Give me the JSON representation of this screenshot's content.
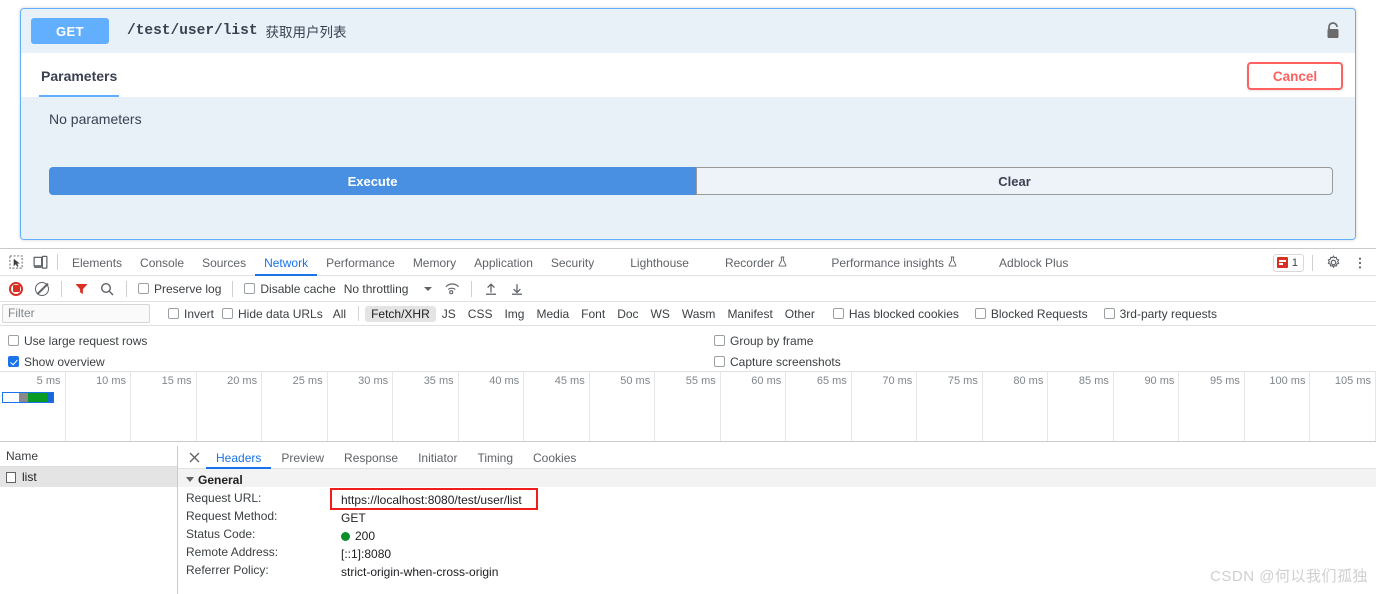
{
  "swagger": {
    "method": "GET",
    "path": "/test/user/list",
    "summary": "获取用户列表",
    "lock_icon": "unlocked-padlock-icon",
    "tab_parameters": "Parameters",
    "cancel_label": "Cancel",
    "no_parameters": "No parameters",
    "execute_label": "Execute",
    "clear_label": "Clear",
    "accent": "#61affe",
    "execute_color": "#4990e2",
    "cancel_color": "#ff6060"
  },
  "devtools": {
    "inspect_icon": "inspect-element-icon",
    "device_icon": "device-toolbar-icon",
    "tabs": [
      {
        "label": "Elements",
        "active": false,
        "experiment": false
      },
      {
        "label": "Console",
        "active": false,
        "experiment": false
      },
      {
        "label": "Sources",
        "active": false,
        "experiment": false
      },
      {
        "label": "Network",
        "active": true,
        "experiment": false
      },
      {
        "label": "Performance",
        "active": false,
        "experiment": false
      },
      {
        "label": "Memory",
        "active": false,
        "experiment": false
      },
      {
        "label": "Application",
        "active": false,
        "experiment": false
      },
      {
        "label": "Security",
        "active": false,
        "experiment": false
      },
      {
        "label": "Lighthouse",
        "active": false,
        "experiment": false
      },
      {
        "label": "Recorder",
        "active": false,
        "experiment": true
      },
      {
        "label": "Performance insights",
        "active": false,
        "experiment": true
      },
      {
        "label": "Adblock Plus",
        "active": false,
        "experiment": false
      }
    ],
    "error_count": "1",
    "settings_icon": "gear-icon",
    "more_icon": "kebab-menu-icon",
    "toolbar": {
      "record_icon": "record-stop-icon",
      "clear_icon": "clear-network-log-icon",
      "filter_icon": "filter-funnel-icon",
      "search_icon": "search-icon",
      "preserve_log": {
        "label": "Preserve log",
        "checked": false
      },
      "disable_cache": {
        "label": "Disable cache",
        "checked": false
      },
      "throttling": "No throttling",
      "wifi_icon": "network-conditions-icon",
      "import_icon": "import-har-icon",
      "export_icon": "export-har-icon"
    },
    "filterbar": {
      "filter_placeholder": "Filter",
      "filter_value": "",
      "invert": {
        "label": "Invert",
        "checked": false
      },
      "hide_data_urls": {
        "label": "Hide data URLs",
        "checked": false
      },
      "types": [
        {
          "label": "All",
          "selected": false
        },
        {
          "label": "Fetch/XHR",
          "selected": true
        },
        {
          "label": "JS",
          "selected": false
        },
        {
          "label": "CSS",
          "selected": false
        },
        {
          "label": "Img",
          "selected": false
        },
        {
          "label": "Media",
          "selected": false
        },
        {
          "label": "Font",
          "selected": false
        },
        {
          "label": "Doc",
          "selected": false
        },
        {
          "label": "WS",
          "selected": false
        },
        {
          "label": "Wasm",
          "selected": false
        },
        {
          "label": "Manifest",
          "selected": false
        },
        {
          "label": "Other",
          "selected": false
        }
      ],
      "has_blocked_cookies": {
        "label": "Has blocked cookies",
        "checked": false
      },
      "blocked_requests": {
        "label": "Blocked Requests",
        "checked": false
      },
      "third_party": {
        "label": "3rd-party requests",
        "checked": false
      }
    },
    "settings": {
      "use_large_request_rows": {
        "label": "Use large request rows",
        "checked": false
      },
      "show_overview": {
        "label": "Show overview",
        "checked": true
      },
      "group_by_frame": {
        "label": "Group by frame",
        "checked": false
      },
      "capture_screenshots": {
        "label": "Capture screenshots",
        "checked": false
      }
    },
    "overview": {
      "ticks": [
        "5 ms",
        "10 ms",
        "15 ms",
        "20 ms",
        "25 ms",
        "30 ms",
        "35 ms",
        "40 ms",
        "45 ms",
        "50 ms",
        "55 ms",
        "60 ms",
        "65 ms",
        "70 ms",
        "75 ms",
        "80 ms",
        "85 ms",
        "90 ms",
        "95 ms",
        "100 ms",
        "105 ms"
      ]
    },
    "requests": {
      "column_header": "Name",
      "rows": [
        {
          "name": "list",
          "selected": true
        }
      ]
    },
    "detail_tabs": [
      {
        "label": "Headers",
        "active": true
      },
      {
        "label": "Preview",
        "active": false
      },
      {
        "label": "Response",
        "active": false
      },
      {
        "label": "Initiator",
        "active": false
      },
      {
        "label": "Timing",
        "active": false
      },
      {
        "label": "Cookies",
        "active": false
      }
    ],
    "close_icon": "close-icon",
    "general": {
      "section_label": "General",
      "fields": [
        {
          "key": "Request URL:",
          "value": "https://localhost:8080/test/user/list",
          "highlight": true
        },
        {
          "key": "Request Method:",
          "value": "GET",
          "highlight": false
        },
        {
          "key": "Status Code:",
          "value": "200",
          "highlight": false,
          "status_dot": "#0a8f29"
        },
        {
          "key": "Remote Address:",
          "value": "[::1]:8080",
          "highlight": false
        },
        {
          "key": "Referrer Policy:",
          "value": "strict-origin-when-cross-origin",
          "highlight": false
        }
      ]
    }
  },
  "watermark": "CSDN @何以我们孤独"
}
